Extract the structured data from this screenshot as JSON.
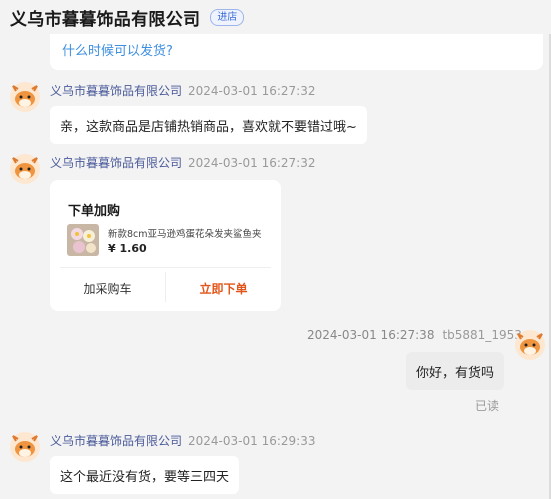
{
  "header": {
    "shop_name": "义乌市暮暮饰品有限公司",
    "enter_label": "进店"
  },
  "previous_message": {
    "text": "什么时候可以发货?"
  },
  "messages": [
    {
      "sender": "义乌市暮暮饰品有限公司",
      "time": "2024-03-01 16:27:32",
      "text": "亲，这款商品是店铺热销商品，喜欢就不要错过哦~"
    },
    {
      "sender": "义乌市暮暮饰品有限公司",
      "time": "2024-03-01 16:27:32"
    },
    {
      "sender": "tb5881_1953",
      "time": "2024-03-01 16:27:38",
      "text": "你好，有货吗",
      "status": "已读"
    },
    {
      "sender": "义乌市暮暮饰品有限公司",
      "time": "2024-03-01 16:29:33",
      "text": "这个最近没有货，要等三四天"
    }
  ],
  "order_card": {
    "title": "下单加购",
    "product_name": "新款8cm亚马逊鸡蛋花朵发夹鲨鱼夹",
    "price": "¥ 1.60",
    "add_cart_label": "加采购车",
    "order_now_label": "立即下单"
  },
  "colors": {
    "accent_orange": "#e2551a",
    "link_blue": "#3d8fe0",
    "badge_blue": "#3a6bd6"
  },
  "icons": {
    "avatar": "cartoon-deer-avatar-icon",
    "product_thumb": "flower-hairclip-thumbnail"
  }
}
